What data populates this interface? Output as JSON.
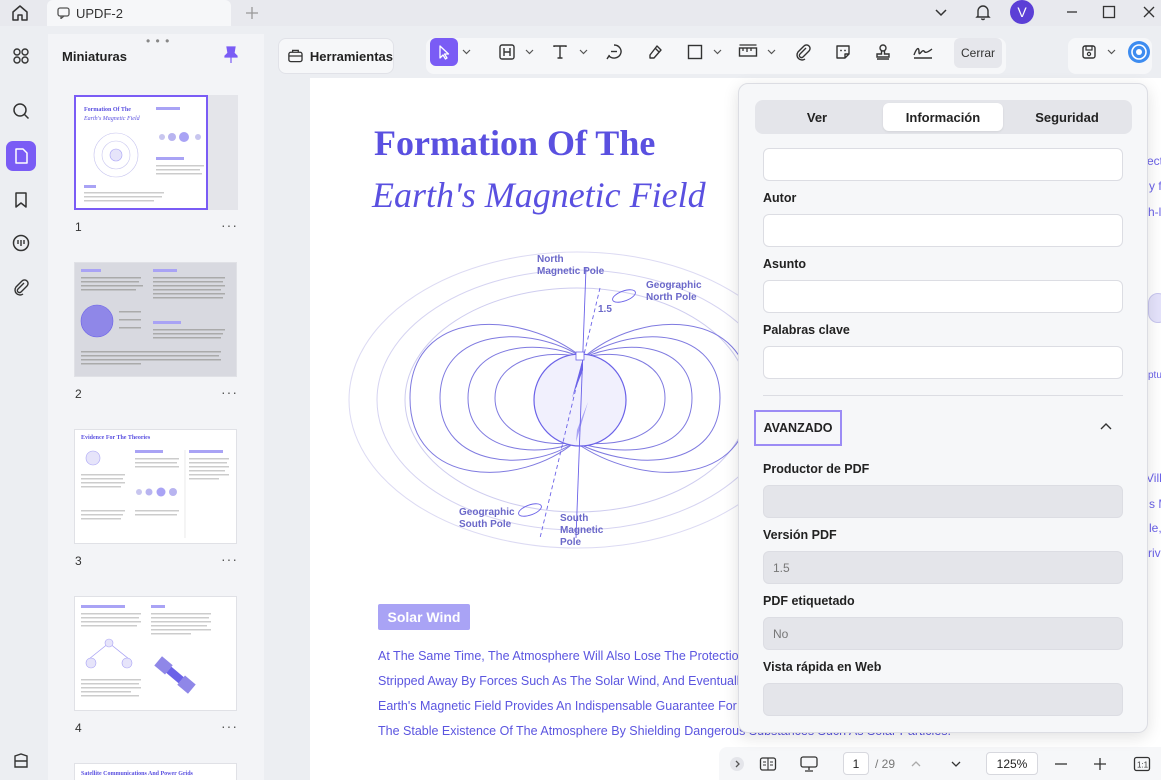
{
  "titlebar": {
    "tab_label": "UPDF-2",
    "user_initial": "V"
  },
  "thumbnails": {
    "title": "Miniaturas",
    "drag_handle": "• • •",
    "items": [
      {
        "page": "1",
        "more": "···"
      },
      {
        "page": "2",
        "more": "···"
      },
      {
        "page": "3",
        "more": "···"
      },
      {
        "page": "4",
        "more": "···"
      }
    ],
    "thumb3_heading": "Evidence For The Theories",
    "thumb5_heading": "Satellite Communications And Power Grids"
  },
  "toolbar": {
    "tools_label": "Herramientas",
    "close_label": "Cerrar"
  },
  "document": {
    "title_line1": "Formation Of The",
    "title_line2": "Earth's Magnetic Field",
    "diagram_labels": {
      "north_magnetic": "North\nMagnetic Pole",
      "geo_north": "Geographic\nNorth Pole",
      "angle": "1.5",
      "geo_south": "Geographic\nSouth Pole",
      "south_magnetic": "South\nMagnetic\nPole"
    },
    "section_badge": "Solar Wind",
    "body_lines": [
      "At The Same Time, The Atmosphere Will Also Lose The Protection Of",
      "Stripped Away By Forces Such As The Solar Wind, And Eventually Di",
      "Earth's Magnetic Field Provides An Indispensable Guarantee For The",
      "The Stable Existence Of The Atmosphere By Shielding Dangerous Substances Such As Solar Particles."
    ],
    "peek_right": [
      "ect",
      "y f",
      "h-l",
      "ptu",
      "Vill",
      "s M",
      "le,",
      "rive"
    ]
  },
  "properties": {
    "tabs": [
      {
        "label": "Ver",
        "active": false
      },
      {
        "label": "Información",
        "active": true
      },
      {
        "label": "Seguridad",
        "active": false
      }
    ],
    "fields": {
      "title_value": "",
      "author_label": "Autor",
      "author_value": "",
      "subject_label": "Asunto",
      "subject_value": "",
      "keywords_label": "Palabras clave",
      "keywords_value": ""
    },
    "advanced_label": "AVANZADO",
    "advanced": {
      "producer_label": "Productor de PDF",
      "producer_value": "",
      "version_label": "Versión PDF",
      "version_value": "1.5",
      "tagged_label": "PDF etiquetado",
      "tagged_value": "No",
      "fastweb_label": "Vista rápida en Web",
      "fastweb_value": ""
    }
  },
  "pagination": {
    "current_page": "1",
    "total": "/ 29",
    "zoom": "125%"
  },
  "colors": {
    "accent": "#7a5cf5",
    "doc_text": "#5a50e0",
    "badge": "#a9a3f5"
  }
}
